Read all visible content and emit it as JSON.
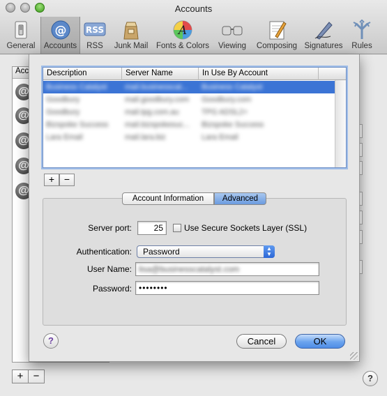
{
  "window": {
    "title": "Accounts"
  },
  "toolbar": {
    "items": [
      {
        "label": "General",
        "icon": "light-switch-icon"
      },
      {
        "label": "Accounts",
        "icon": "at-sign-icon"
      },
      {
        "label": "RSS",
        "icon": "rss-icon"
      },
      {
        "label": "Junk Mail",
        "icon": "junk-mail-icon"
      },
      {
        "label": "Fonts & Colors",
        "icon": "fonts-colors-icon"
      },
      {
        "label": "Viewing",
        "icon": "glasses-icon"
      },
      {
        "label": "Composing",
        "icon": "pencil-paper-icon"
      },
      {
        "label": "Signatures",
        "icon": "pen-icon"
      },
      {
        "label": "Rules",
        "icon": "rules-icon"
      }
    ],
    "rss_text": "RSS",
    "fonts_text": "A"
  },
  "background": {
    "accounts_header": "Acc",
    "account_icon_glyph": "@"
  },
  "sheet": {
    "table": {
      "columns": [
        "Description",
        "Server Name",
        "In Use By Account"
      ],
      "rows": [
        [
          "Business Catalyst",
          "mail.businesscat...",
          "Business Catalyst"
        ],
        [
          "Goodbury",
          "mail.goodbury.com",
          "Goodbury.com"
        ],
        [
          "Goodbury",
          "mail.tpg.com.au",
          "TPG ADSL2+"
        ],
        [
          "Bizspoke Success",
          "mail.bizspokesuc...",
          "Bizspoke Success"
        ],
        [
          "Lara Email",
          "mail.lara.biz",
          "Lara Email"
        ]
      ]
    },
    "add_button": "+",
    "remove_button": "−",
    "tabs": {
      "account_information": "Account Information",
      "advanced": "Advanced"
    },
    "server_port": {
      "label": "Server port:",
      "value": "25"
    },
    "ssl": {
      "label": "Use Secure Sockets Layer (SSL)"
    },
    "authentication": {
      "label": "Authentication:",
      "value": "Password"
    },
    "user_name": {
      "label": "User Name:",
      "value": "lisa@businesscatalyst.com"
    },
    "password": {
      "label": "Password:",
      "value": "••••••••"
    },
    "help": "?",
    "cancel": "Cancel",
    "ok": "OK"
  },
  "footer": {
    "add_button": "+",
    "remove_button": "−",
    "help": "?"
  },
  "colors": {
    "selection_blue": "#3b74d5",
    "default_button_blue": "#6aa3ee",
    "help_icon_purple": "#6b3fa0"
  }
}
